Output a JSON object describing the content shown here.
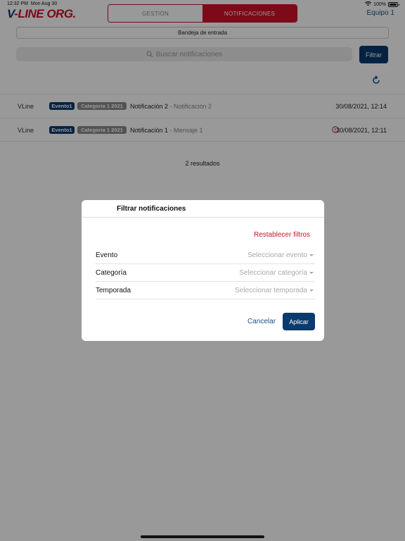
{
  "status_bar": {
    "time": "12:32 PM",
    "date": "Mon Aug 30",
    "battery": "100%"
  },
  "header": {
    "logo_prefix": "V",
    "logo_rest": "-LINE ORG.",
    "tabs": [
      {
        "label": "GESTIÓN",
        "active": false
      },
      {
        "label": "NOTIFICACIONES",
        "active": true
      }
    ],
    "team": "Equipo 1"
  },
  "inbox": {
    "label": "Bandeja de entrada"
  },
  "search": {
    "placeholder": "Buscar notificaciones",
    "filter_label": "Filtrar"
  },
  "notifications": [
    {
      "sender": "VLine",
      "event": "Evento1",
      "category": "Categoria 1 2021",
      "title": "Notificación 2",
      "subtitle": " - Notificación 2",
      "date": "30/08/2021, 12:14",
      "warning": false
    },
    {
      "sender": "VLine",
      "event": "Evento1",
      "category": "Categoria 1 2021",
      "title": "Notificación 1",
      "subtitle": " - Mensaje 1",
      "date": "30/08/2021, 12:11",
      "warning": true
    }
  ],
  "results": "2 resultados",
  "modal": {
    "title": "Filtrar notificaciones",
    "reset": "Restablecer filtros",
    "fields": [
      {
        "label": "Evento",
        "placeholder": "Seleccionar evento"
      },
      {
        "label": "Categoría",
        "placeholder": "Seleccionar categoría"
      },
      {
        "label": "Temporada",
        "placeholder": "Seleccionar temporada"
      }
    ],
    "cancel": "Cancelar",
    "apply": "Aplicar"
  },
  "colors": {
    "brand_red": "#d0112b",
    "brand_blue": "#0b3a6e",
    "link_blue": "#1a4f8a"
  }
}
